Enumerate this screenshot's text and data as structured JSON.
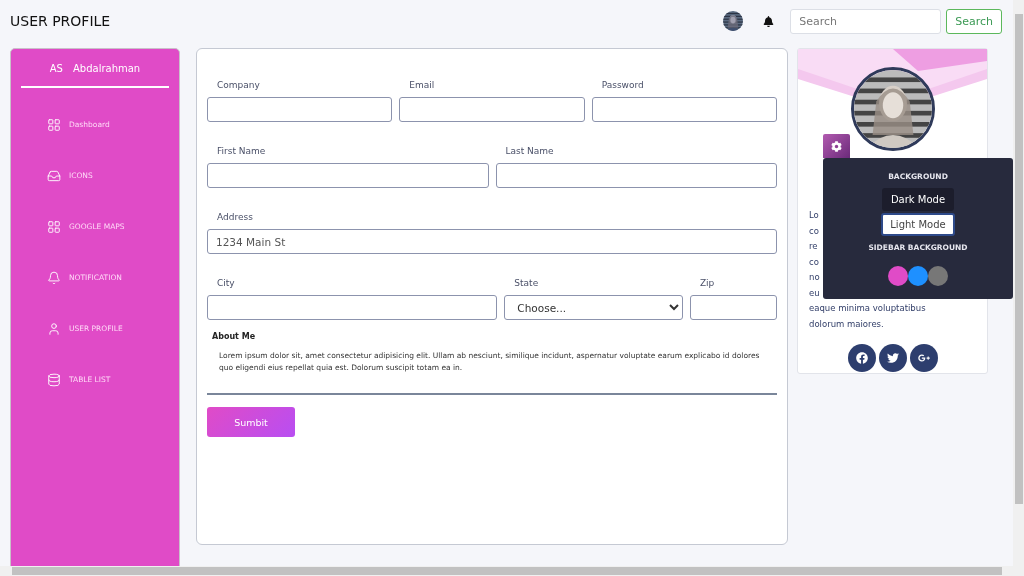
{
  "header": {
    "title": "USER PROFILE",
    "search": {
      "placeholder": "Search"
    },
    "search_button": "Search"
  },
  "sidebar": {
    "initials": "AS",
    "user": "Abdalrahman",
    "items": [
      {
        "label": "Dashboard"
      },
      {
        "label": "ICONS"
      },
      {
        "label": "GOOGLE MAPS"
      },
      {
        "label": "NOTIFICATION"
      },
      {
        "label": "USER PROFILE"
      },
      {
        "label": "TABLE LIST"
      }
    ]
  },
  "form": {
    "rows": [
      [
        {
          "label": "Company",
          "kind": "input"
        },
        {
          "label": "Email",
          "kind": "input"
        },
        {
          "label": "Password",
          "kind": "input"
        }
      ],
      [
        {
          "label": "First Name",
          "kind": "input"
        },
        {
          "label": "Last Name",
          "kind": "input"
        }
      ],
      [
        {
          "label": "Address",
          "kind": "input",
          "value": "1234 Main St"
        }
      ],
      [
        {
          "label": "City",
          "kind": "input"
        },
        {
          "label": "State",
          "kind": "select",
          "value": "Choose..."
        },
        {
          "label": "Zip",
          "kind": "input"
        }
      ]
    ],
    "about_label": "About Me",
    "about_text": "Lorem ipsum dolor sit, amet consectetur adipisicing elit. Ullam ab nesciunt, similique incidunt, aspernatur voluptate earum explicabo id dolores quo eligendi eius repellat quia est. Dolorum suscipit totam ea in.",
    "submit": "Sumbit"
  },
  "profile_card": {
    "text_lines": [
      "Lo",
      "co",
      "re",
      "co",
      "no",
      "eu",
      "eaque minima voluptatibus",
      "dolorum maiores."
    ]
  },
  "settings_popup": {
    "background_title": "BACKGROUND",
    "modes": [
      {
        "label": "Dark Mode",
        "selected": false
      },
      {
        "label": "Light Mode",
        "selected": true
      }
    ],
    "sidebar_title": "SIDEBAR BACKGROUND",
    "colors": [
      {
        "color": "#e04bc7"
      },
      {
        "color": "#1e90ff"
      },
      {
        "color": "#777777"
      }
    ]
  }
}
